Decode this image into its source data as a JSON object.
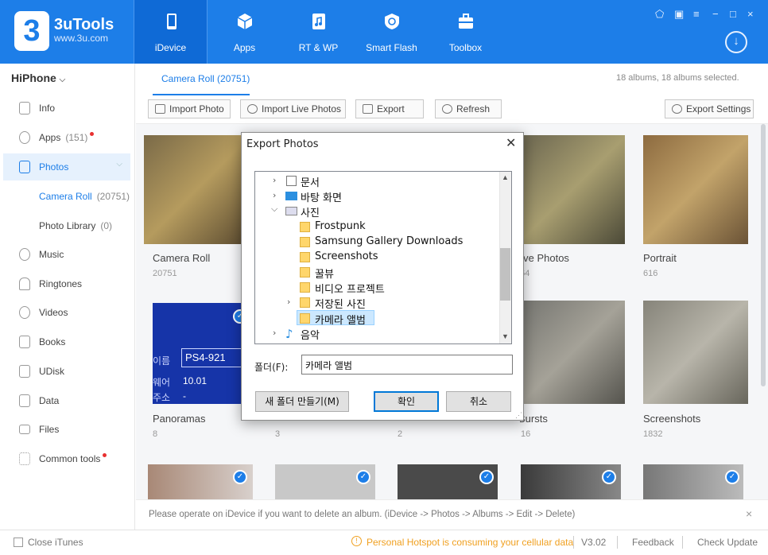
{
  "app": {
    "name": "3uTools",
    "url": "www.3u.com",
    "logo_char": "3"
  },
  "nav": [
    {
      "label": "iDevice"
    },
    {
      "label": "Apps"
    },
    {
      "label": "RT & WP"
    },
    {
      "label": "Smart Flash"
    },
    {
      "label": "Toolbox"
    }
  ],
  "window_controls": [
    "⬠",
    "▣",
    "≡",
    "−",
    "□",
    "×"
  ],
  "download_icon": "↓",
  "sidebar": {
    "device": "HiPhone",
    "items": [
      {
        "label": "Info",
        "count": ""
      },
      {
        "label": "Apps",
        "count": "(151)"
      },
      {
        "label": "Photos",
        "count": ""
      },
      {
        "label": "Music",
        "count": ""
      },
      {
        "label": "Ringtones",
        "count": ""
      },
      {
        "label": "Videos",
        "count": ""
      },
      {
        "label": "Books",
        "count": ""
      },
      {
        "label": "UDisk",
        "count": ""
      },
      {
        "label": "Data",
        "count": ""
      },
      {
        "label": "Files",
        "count": ""
      },
      {
        "label": "Common tools",
        "count": ""
      }
    ],
    "subitems": [
      {
        "label": "Camera Roll",
        "count": "(20751)"
      },
      {
        "label": "Photo Library",
        "count": "(0)"
      }
    ]
  },
  "tab": {
    "label": "Camera Roll (20751)"
  },
  "albums_info": "18 albums, 18 albums selected.",
  "toolbar": {
    "import_photo": "Import Photo",
    "import_live": "Import Live Photos",
    "export": "Export",
    "refresh": "Refresh",
    "export_settings": "Export Settings"
  },
  "albums": [
    {
      "name": "Camera Roll",
      "count": "20751"
    },
    {
      "name": "Live Photos",
      "count": "464"
    },
    {
      "name": "Portrait",
      "count": "616"
    },
    {
      "name": "Panoramas",
      "count": "8"
    },
    {
      "name": "",
      "count": "3"
    },
    {
      "name": "",
      "count": "2"
    },
    {
      "name": "Bursts",
      "count": "16"
    },
    {
      "name": "Screenshots",
      "count": "1832"
    }
  ],
  "thumb_text": {
    "label1": "이름",
    "value1": "PS4-921",
    "label2": "웨어",
    "value2": "10.01",
    "label3": "주소",
    "value3": "-"
  },
  "notice": "Please operate on iDevice if you want to delete an album.  (iDevice -> Photos -> Albums -> Edit -> Delete)",
  "status": {
    "close_itunes": "Close iTunes",
    "hotspot": "Personal Hotspot is consuming your cellular data",
    "version": "V3.02",
    "feedback": "Feedback",
    "check_update": "Check Update"
  },
  "dialog": {
    "title": "Export Photos",
    "tree": [
      {
        "name": "문서"
      },
      {
        "name": "바탕 화면"
      },
      {
        "name": "사진"
      },
      {
        "name": "Frostpunk"
      },
      {
        "name": "Samsung Gallery Downloads"
      },
      {
        "name": "Screenshots"
      },
      {
        "name": "꿀뷰"
      },
      {
        "name": "비디오 프로젝트"
      },
      {
        "name": "저장된 사진"
      },
      {
        "name": "카메라 앨범"
      },
      {
        "name": "음악"
      }
    ],
    "folder_label": "폴더(F):",
    "folder_value": "카메라 앨범",
    "new_folder": "새 폴더 만들기(M)",
    "ok": "확인",
    "cancel": "취소"
  },
  "colors": {
    "accent": "#1d7ee8",
    "notification_dot": "#e83030",
    "warning": "#f0a020"
  }
}
